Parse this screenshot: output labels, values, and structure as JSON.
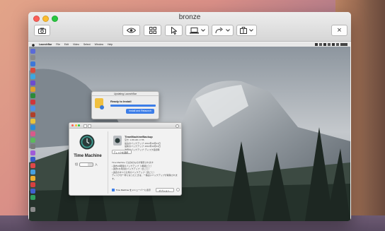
{
  "window": {
    "title": "bronze",
    "toolbar_close_label": "×"
  },
  "menubar": {
    "items": [
      "LaunchBar",
      "File",
      "Edit",
      "Video",
      "Select",
      "Window",
      "Help"
    ]
  },
  "launcher": {
    "title": "Updating LaunchBar",
    "status": "Ready to Install",
    "button": "Install and Relaunch"
  },
  "tm": {
    "title": "Time Machine",
    "toggle_off": "切",
    "toggle_on": "入",
    "select_disk_button": "ディスクを選択...",
    "disk_name": "TimeMachineBackup",
    "disk_details": [
      "空き: 1.86 GB / 2 TB",
      "最古のバックアップ: 2014年10月21日",
      "最新のバックアップ: 2014年10月31日",
      "次回のバックアップ: ディスク接続時"
    ],
    "description": [
      "Time Machine では次のものが保存されます:",
      "• 過去24時間のバックアップ（1時間ごと）",
      "• 過去1か月間のバックアップ（日ごと）",
      "• 過去のすべての月のバックアップ（週ごと）",
      "ディスクが一杯になったときは、一番古いバックアップが削除されます。"
    ],
    "menu_checkbox": "Time Machine をメニューバーに表示",
    "options_button": "オプション..."
  }
}
